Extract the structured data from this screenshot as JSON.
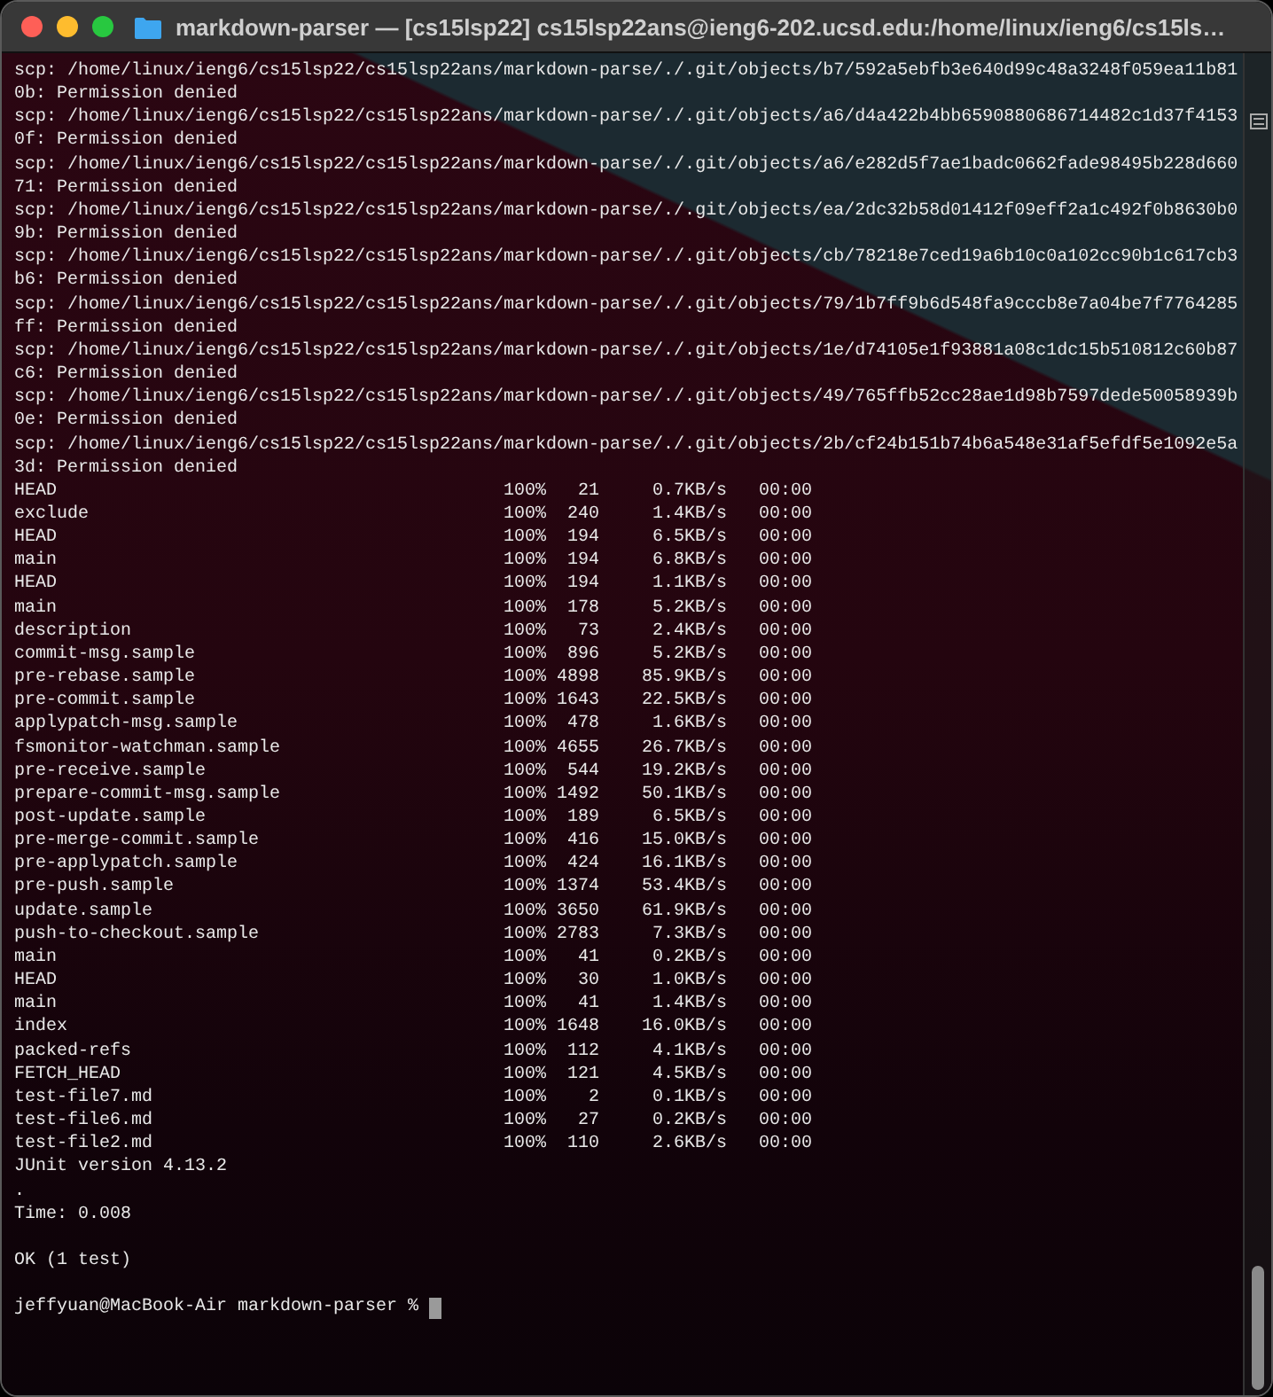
{
  "window": {
    "title": "markdown-parser — [cs15lsp22]  cs15lsp22ans@ieng6-202.ucsd.edu:/home/linux/ieng6/cs15ls…"
  },
  "scp_errors": [
    "scp: /home/linux/ieng6/cs15lsp22/cs15lsp22ans/markdown-parse/./.git/objects/b7/592a5ebfb3e640d99c48a3248f059ea11b810b: Permission denied",
    "scp: /home/linux/ieng6/cs15lsp22/cs15lsp22ans/markdown-parse/./.git/objects/a6/d4a422b4bb6590880686714482c1d37f41530f: Permission denied",
    "scp: /home/linux/ieng6/cs15lsp22/cs15lsp22ans/markdown-parse/./.git/objects/a6/e282d5f7ae1badc0662fade98495b228d66071: Permission denied",
    "scp: /home/linux/ieng6/cs15lsp22/cs15lsp22ans/markdown-parse/./.git/objects/ea/2dc32b58d01412f09eff2a1c492f0b8630b09b: Permission denied",
    "scp: /home/linux/ieng6/cs15lsp22/cs15lsp22ans/markdown-parse/./.git/objects/cb/78218e7ced19a6b10c0a102cc90b1c617cb3b6: Permission denied",
    "scp: /home/linux/ieng6/cs15lsp22/cs15lsp22ans/markdown-parse/./.git/objects/79/1b7ff9b6d548fa9cccb8e7a04be7f7764285ff: Permission denied",
    "scp: /home/linux/ieng6/cs15lsp22/cs15lsp22ans/markdown-parse/./.git/objects/1e/d74105e1f93881a08c1dc15b510812c60b87c6: Permission denied",
    "scp: /home/linux/ieng6/cs15lsp22/cs15lsp22ans/markdown-parse/./.git/objects/49/765ffb52cc28ae1d98b7597dede50058939b0e: Permission denied",
    "scp: /home/linux/ieng6/cs15lsp22/cs15lsp22ans/markdown-parse/./.git/objects/2b/cf24b151b74b6a548e31af5efdf5e1092e5a3d: Permission denied"
  ],
  "transfers": [
    {
      "name": "HEAD",
      "percent": "100%",
      "size": "21",
      "rate": "0.7KB/s",
      "time": "00:00"
    },
    {
      "name": "exclude",
      "percent": "100%",
      "size": "240",
      "rate": "1.4KB/s",
      "time": "00:00"
    },
    {
      "name": "HEAD",
      "percent": "100%",
      "size": "194",
      "rate": "6.5KB/s",
      "time": "00:00"
    },
    {
      "name": "main",
      "percent": "100%",
      "size": "194",
      "rate": "6.8KB/s",
      "time": "00:00"
    },
    {
      "name": "HEAD",
      "percent": "100%",
      "size": "194",
      "rate": "1.1KB/s",
      "time": "00:00"
    },
    {
      "name": "main",
      "percent": "100%",
      "size": "178",
      "rate": "5.2KB/s",
      "time": "00:00"
    },
    {
      "name": "description",
      "percent": "100%",
      "size": "73",
      "rate": "2.4KB/s",
      "time": "00:00"
    },
    {
      "name": "commit-msg.sample",
      "percent": "100%",
      "size": "896",
      "rate": "5.2KB/s",
      "time": "00:00"
    },
    {
      "name": "pre-rebase.sample",
      "percent": "100%",
      "size": "4898",
      "rate": "85.9KB/s",
      "time": "00:00"
    },
    {
      "name": "pre-commit.sample",
      "percent": "100%",
      "size": "1643",
      "rate": "22.5KB/s",
      "time": "00:00"
    },
    {
      "name": "applypatch-msg.sample",
      "percent": "100%",
      "size": "478",
      "rate": "1.6KB/s",
      "time": "00:00"
    },
    {
      "name": "fsmonitor-watchman.sample",
      "percent": "100%",
      "size": "4655",
      "rate": "26.7KB/s",
      "time": "00:00"
    },
    {
      "name": "pre-receive.sample",
      "percent": "100%",
      "size": "544",
      "rate": "19.2KB/s",
      "time": "00:00"
    },
    {
      "name": "prepare-commit-msg.sample",
      "percent": "100%",
      "size": "1492",
      "rate": "50.1KB/s",
      "time": "00:00"
    },
    {
      "name": "post-update.sample",
      "percent": "100%",
      "size": "189",
      "rate": "6.5KB/s",
      "time": "00:00"
    },
    {
      "name": "pre-merge-commit.sample",
      "percent": "100%",
      "size": "416",
      "rate": "15.0KB/s",
      "time": "00:00"
    },
    {
      "name": "pre-applypatch.sample",
      "percent": "100%",
      "size": "424",
      "rate": "16.1KB/s",
      "time": "00:00"
    },
    {
      "name": "pre-push.sample",
      "percent": "100%",
      "size": "1374",
      "rate": "53.4KB/s",
      "time": "00:00"
    },
    {
      "name": "update.sample",
      "percent": "100%",
      "size": "3650",
      "rate": "61.9KB/s",
      "time": "00:00"
    },
    {
      "name": "push-to-checkout.sample",
      "percent": "100%",
      "size": "2783",
      "rate": "7.3KB/s",
      "time": "00:00"
    },
    {
      "name": "main",
      "percent": "100%",
      "size": "41",
      "rate": "0.2KB/s",
      "time": "00:00"
    },
    {
      "name": "HEAD",
      "percent": "100%",
      "size": "30",
      "rate": "1.0KB/s",
      "time": "00:00"
    },
    {
      "name": "main",
      "percent": "100%",
      "size": "41",
      "rate": "1.4KB/s",
      "time": "00:00"
    },
    {
      "name": "index",
      "percent": "100%",
      "size": "1648",
      "rate": "16.0KB/s",
      "time": "00:00"
    },
    {
      "name": "packed-refs",
      "percent": "100%",
      "size": "112",
      "rate": "4.1KB/s",
      "time": "00:00"
    },
    {
      "name": "FETCH_HEAD",
      "percent": "100%",
      "size": "121",
      "rate": "4.5KB/s",
      "time": "00:00"
    },
    {
      "name": "test-file7.md",
      "percent": "100%",
      "size": "2",
      "rate": "0.1KB/s",
      "time": "00:00"
    },
    {
      "name": "test-file6.md",
      "percent": "100%",
      "size": "27",
      "rate": "0.2KB/s",
      "time": "00:00"
    },
    {
      "name": "test-file2.md",
      "percent": "100%",
      "size": "110",
      "rate": "2.6KB/s",
      "time": "00:00"
    }
  ],
  "test_output": [
    "JUnit version 4.13.2",
    ".",
    "Time: 0.008"
  ],
  "test_result": "OK (1 test)",
  "prompt": "jeffyuan@MacBook-Air markdown-parser %"
}
